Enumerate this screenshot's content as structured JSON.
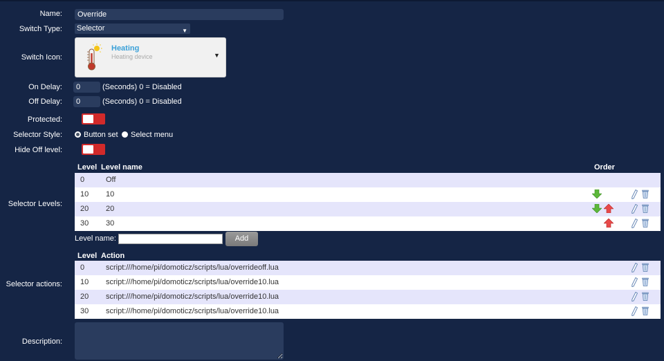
{
  "form": {
    "name_label": "Name:",
    "name_value": "Override",
    "switch_type_label": "Switch Type:",
    "switch_type_value": "Selector",
    "switch_icon_label": "Switch Icon:",
    "icon_title": "Heating",
    "icon_subtitle": "Heating device",
    "on_delay_label": "On Delay:",
    "on_delay_value": "0",
    "on_delay_hint": "(Seconds) 0 = Disabled",
    "off_delay_label": "Off Delay:",
    "off_delay_value": "0",
    "off_delay_hint": "(Seconds) 0 = Disabled",
    "protected_label": "Protected:",
    "protected_on": false,
    "selector_style_label": "Selector Style:",
    "selector_style_options": [
      "Button set",
      "Select menu"
    ],
    "selector_style_selected": "Button set",
    "hide_off_label": "Hide Off level:",
    "hide_off_on": false,
    "selector_levels_label": "Selector Levels:",
    "selector_actions_label": "Selector actions:",
    "description_label": "Description:",
    "description_value": ""
  },
  "levels_table": {
    "headers": {
      "level": "Level",
      "name": "Level name",
      "order": "Order"
    },
    "rows": [
      {
        "level": "0",
        "name": "Off",
        "down": false,
        "up": false,
        "editable": false
      },
      {
        "level": "10",
        "name": "10",
        "down": true,
        "up": false,
        "editable": true
      },
      {
        "level": "20",
        "name": "20",
        "down": true,
        "up": true,
        "editable": true
      },
      {
        "level": "30",
        "name": "30",
        "down": false,
        "up": true,
        "editable": true
      }
    ],
    "level_name_label": "Level name:",
    "level_name_value": "",
    "add_label": "Add"
  },
  "actions_table": {
    "headers": {
      "level": "Level",
      "action": "Action"
    },
    "rows": [
      {
        "level": "0",
        "action": "script:///home/pi/domoticz/scripts/lua/overrideoff.lua"
      },
      {
        "level": "10",
        "action": "script:///home/pi/domoticz/scripts/lua/override10.lua"
      },
      {
        "level": "20",
        "action": "script:///home/pi/domoticz/scripts/lua/override10.lua"
      },
      {
        "level": "30",
        "action": "script:///home/pi/domoticz/scripts/lua/override10.lua"
      }
    ]
  },
  "colors": {
    "background": "#152545",
    "field": "#2a3c5e",
    "toggle_off": "#d22a2a",
    "row_alt": "#e5e5fb",
    "icon_title": "#3aa0d8"
  }
}
